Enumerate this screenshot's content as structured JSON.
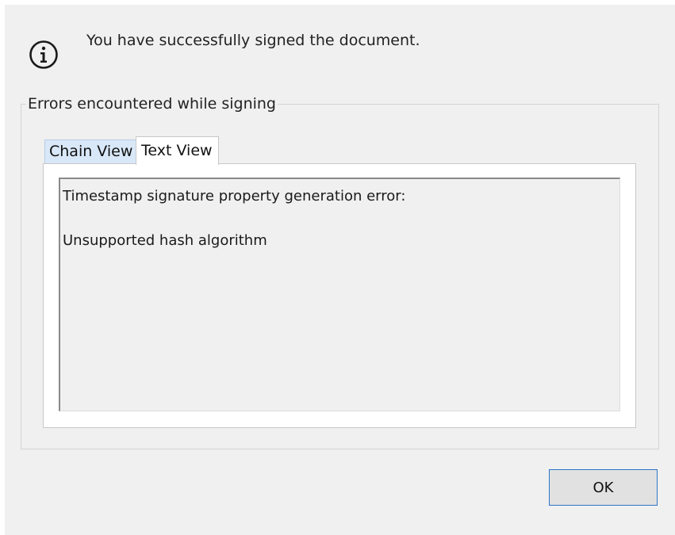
{
  "dialog": {
    "message": "You have successfully signed the document.",
    "icon": "info-icon"
  },
  "group": {
    "legend": "Errors encountered while signing"
  },
  "tabs": [
    {
      "label": "Chain View",
      "selected": false
    },
    {
      "label": "Text View",
      "selected": true
    }
  ],
  "text_view": {
    "line1": "Timestamp signature property generation error:",
    "line2": "Unsupported hash algorithm"
  },
  "buttons": {
    "ok_label": "OK"
  },
  "colors": {
    "dialog_bg": "#f0f0f0",
    "selected_tab_bg": "#ffffff",
    "unselected_tab_bg": "#d9e8f8",
    "button_focus_border": "#2f74c8"
  }
}
